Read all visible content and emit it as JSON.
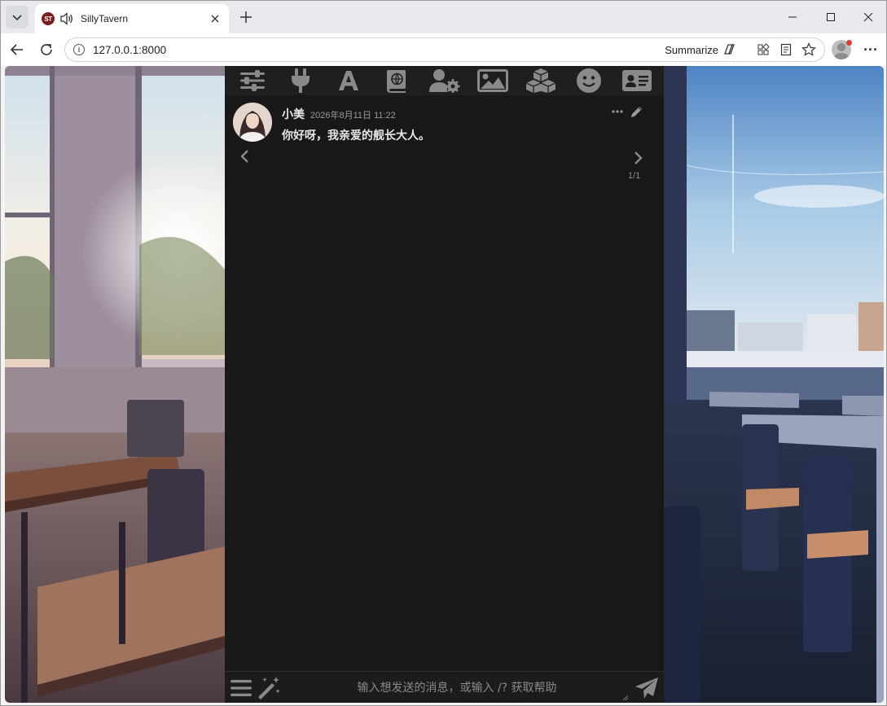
{
  "browser": {
    "tab": {
      "title": "SillyTavern",
      "favicon_text": "ST",
      "audio_icon": "speaker-icon",
      "close_icon": "close-icon"
    },
    "new_tab_icon": "plus-icon",
    "window_controls": [
      "minimize-icon",
      "maximize-icon",
      "close-icon"
    ],
    "toolbar": {
      "url": "127.0.0.1:8000",
      "summarize_label": "Summarize",
      "icons": [
        "back-icon",
        "reload-icon",
        "info-icon",
        "copilot-icon",
        "extensions-icon",
        "reading-mode-icon",
        "star-icon",
        "profile-icon",
        "more-menu-icon"
      ],
      "menu_glyph": "···"
    }
  },
  "app": {
    "topbar_icons": [
      "sliders-icon",
      "plug-icon",
      "font-icon",
      "book-icon",
      "user-gear-icon",
      "image-icon",
      "cubes-icon",
      "smile-icon",
      "id-card-icon"
    ],
    "message": {
      "name": "小美",
      "timestamp": "2026年8月11日 11:22",
      "text": "你好呀，我亲爱的舰长大人。",
      "swipe_counter": "1/1"
    },
    "input": {
      "placeholder": "输入想发送的消息，或输入 /? 获取帮助",
      "value": ""
    },
    "colors": {
      "panel": "#181818",
      "topbar": "#1f1f1f",
      "icon": "#8a8a8a",
      "text": "#e8e8e8",
      "muted": "#9a9a9a"
    }
  }
}
